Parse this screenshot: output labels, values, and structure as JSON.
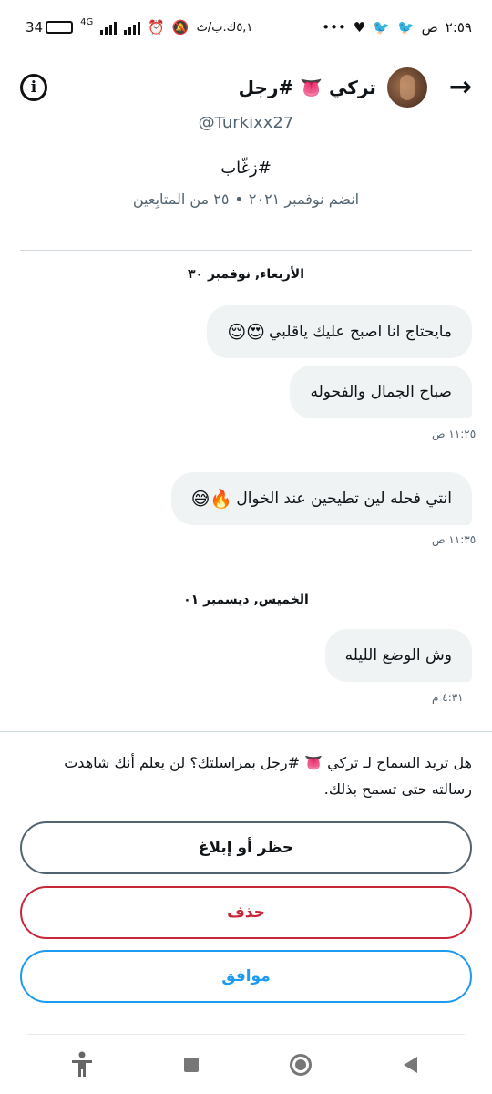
{
  "status_bar": {
    "time": "٢:٥٩",
    "am_pm": "ص",
    "data_speed": "٥,١ك.ب/ث",
    "network": "4G",
    "battery_level": "34",
    "battery_fraction": 0.4,
    "dots": "•••"
  },
  "header": {
    "title": "تركي 👅 #رجل",
    "info_glyph": "i",
    "back_glyph": "→"
  },
  "profile": {
    "handle": "@Turkixx27",
    "bio": "#زغّاب",
    "joined": "انضم نوفمبر ٢٠٢١",
    "bullet": "•",
    "followers": "٢٥ من المتابِعين"
  },
  "conversation": {
    "day1": "الأربعاء, نوفمبر ٣٠",
    "day2": "الخميس, ديسمبر ٠١",
    "messages": [
      {
        "text": "مايحتاج انا اصبح عليك ياقلبي",
        "emoji": "😍😌"
      },
      {
        "text": "صباح الجمال والفحوله",
        "emoji": ""
      },
      {
        "text": "انتي فحله لين تطيحين عند الخوال",
        "emoji": "🔥😅"
      },
      {
        "text": "وش الوضع الليله",
        "emoji": ""
      }
    ],
    "timestamps": [
      "١١:٢٥ ص",
      "١١:٣٥ ص",
      "٤:٣١ م"
    ]
  },
  "request": {
    "prompt": "هل تريد السماح لـ تركي 👅 #رجل بمراسلتك؟ لن يعلم أنك شاهدت رسالته حتى تسمح بذلك.",
    "block_label": "حظر أو إبلاغ",
    "delete_label": "حذف",
    "accept_label": "موافق"
  },
  "colors": {
    "accent": "#1d9bf0",
    "danger": "#c8273a",
    "bubble": "#eff3f4",
    "muted": "#536471"
  },
  "nav_icons": [
    "accessibility-icon",
    "recents-icon",
    "home-icon",
    "back-icon"
  ]
}
